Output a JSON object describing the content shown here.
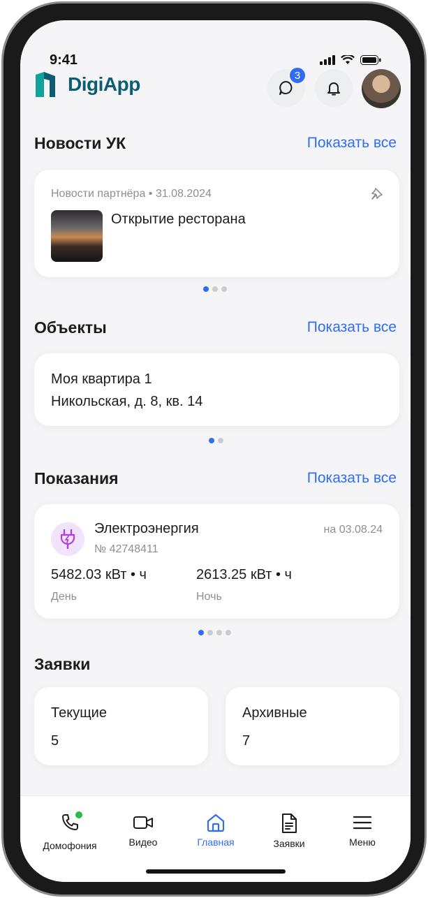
{
  "status_bar": {
    "time": "9:41"
  },
  "header": {
    "app_name": "DigiApp",
    "chat_badge": "3"
  },
  "news": {
    "title": "Новости УК",
    "show_all": "Показать все",
    "item": {
      "meta": "Новости партнёра • 31.08.2024",
      "headline": "Открытие ресторана"
    },
    "pages": 3,
    "active_page": 1
  },
  "objects": {
    "title": "Объекты",
    "show_all": "Показать все",
    "item": {
      "name": "Моя квартира 1",
      "address": "Никольская, д. 8, кв. 14"
    },
    "pages": 2,
    "active_page": 1
  },
  "readings": {
    "title": "Показания",
    "show_all": "Показать все",
    "item": {
      "resource": "Электроэнергия",
      "meter_number": "№ 42748411",
      "date": "на 03.08.24",
      "day_value": "5482.03 кВт • ч",
      "day_label": "День",
      "night_value": "2613.25 кВт • ч",
      "night_label": "Ночь"
    },
    "pages": 4,
    "active_page": 1
  },
  "requests": {
    "title": "Заявки",
    "current_label": "Текущие",
    "current_count": "5",
    "archived_label": "Архивные",
    "archived_count": "7"
  },
  "tabbar": {
    "items": [
      {
        "label": "Домофония",
        "icon": "phone-icon"
      },
      {
        "label": "Видео",
        "icon": "video-icon"
      },
      {
        "label": "Главная",
        "icon": "home-icon",
        "active": true
      },
      {
        "label": "Заявки",
        "icon": "document-icon"
      },
      {
        "label": "Меню",
        "icon": "menu-icon"
      }
    ]
  },
  "colors": {
    "accent": "#2f6df6",
    "logo": "#0b5d73",
    "meter_icon_bg": "#f0e3fb",
    "meter_icon": "#b040e0",
    "online": "#2db84c"
  }
}
